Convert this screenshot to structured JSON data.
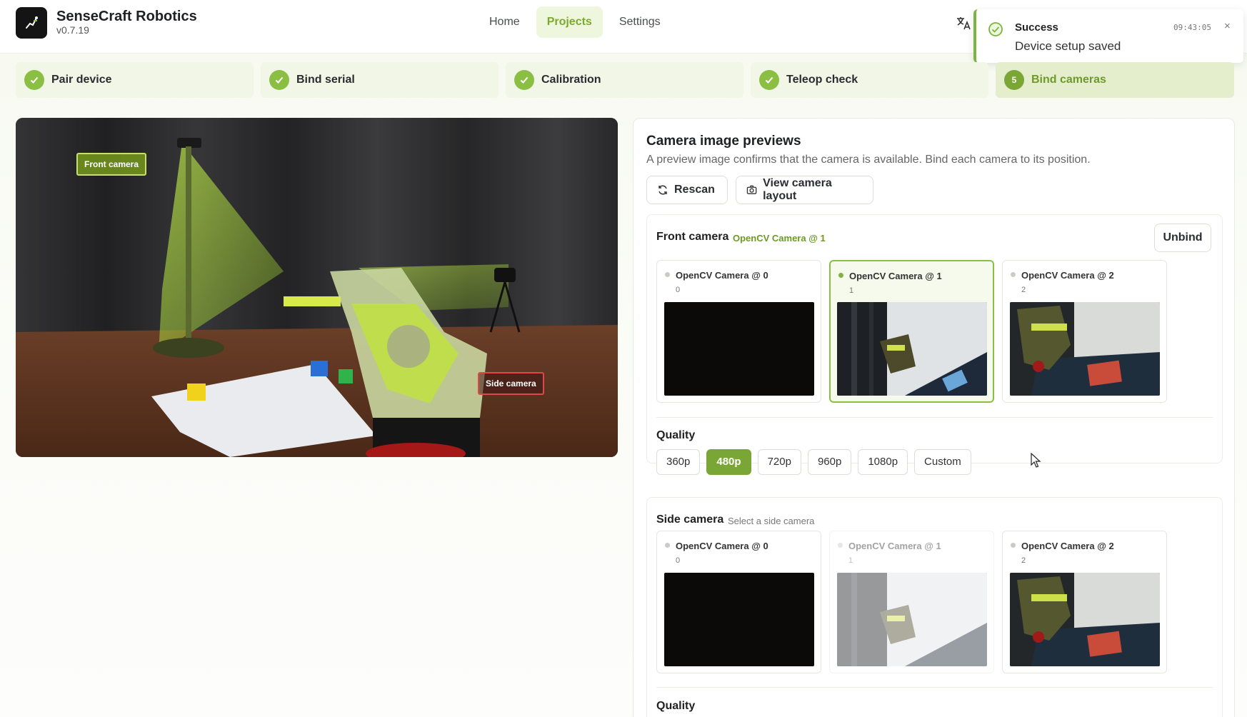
{
  "app": {
    "name": "SenseCraft Robotics",
    "version": "v0.7.19"
  },
  "nav": [
    {
      "label": "Home",
      "active": false
    },
    {
      "label": "Projects",
      "active": true
    },
    {
      "label": "Settings",
      "active": false
    }
  ],
  "toast": {
    "title": "Success",
    "time": "09:43:05",
    "message": "Device setup saved",
    "close": "×"
  },
  "steps": [
    {
      "label": "Pair device",
      "state": "done"
    },
    {
      "label": "Bind serial",
      "state": "done"
    },
    {
      "label": "Calibration",
      "state": "done"
    },
    {
      "label": "Teleop check",
      "state": "done"
    },
    {
      "label": "Bind cameras",
      "state": "current",
      "number": "5"
    }
  ],
  "scene": {
    "front_tag": "Front camera",
    "side_tag": "Side camera"
  },
  "panel": {
    "title": "Camera image previews",
    "description": "A preview image confirms that the camera is available. Bind each camera to its position.",
    "rescan_label": "Rescan",
    "layout_label": "View camera layout"
  },
  "front_camera": {
    "title": "Front camera",
    "bound": "OpenCV Camera @ 1",
    "unbind_label": "Unbind",
    "cameras": [
      {
        "name": "OpenCV Camera @ 0",
        "index": "0",
        "state": "normal"
      },
      {
        "name": "OpenCV Camera @ 1",
        "index": "1",
        "state": "selected"
      },
      {
        "name": "OpenCV Camera @ 2",
        "index": "2",
        "state": "normal"
      }
    ],
    "quality_label": "Quality",
    "qualities": [
      "360p",
      "480p",
      "720p",
      "960p",
      "1080p",
      "Custom"
    ],
    "selected_quality": "480p"
  },
  "side_camera": {
    "title": "Side camera",
    "hint": "Select a side camera",
    "cameras": [
      {
        "name": "OpenCV Camera @ 0",
        "index": "0",
        "state": "normal"
      },
      {
        "name": "OpenCV Camera @ 1",
        "index": "1",
        "state": "disabled"
      },
      {
        "name": "OpenCV Camera @ 2",
        "index": "2",
        "state": "normal"
      }
    ],
    "quality_label": "Quality"
  },
  "colors": {
    "accent": "#7aa636",
    "accent_light": "#eef6de",
    "step_bg": "#f1f6e6"
  },
  "icons": [
    "logo-icon",
    "translate-icon",
    "check-circle-icon",
    "close-icon",
    "check-icon",
    "refresh-icon",
    "camera-icon",
    "cursor-icon"
  ]
}
